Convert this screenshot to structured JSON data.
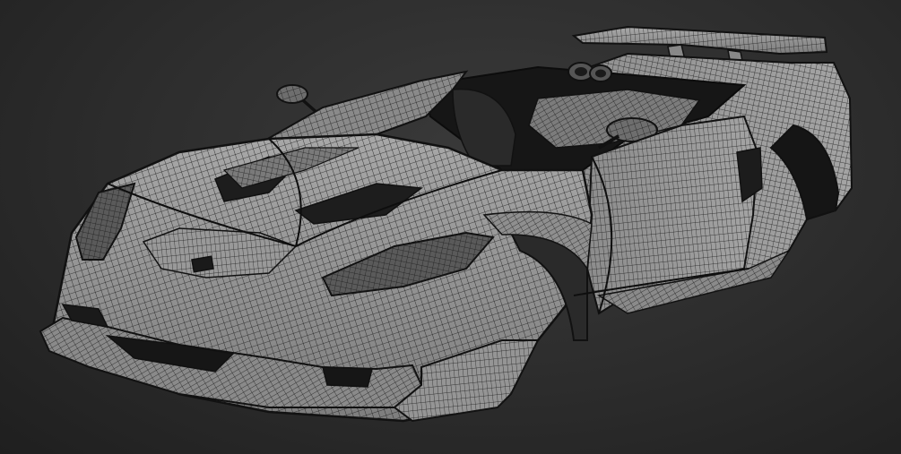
{
  "scene": {
    "subject": "car-body-wireframe-mesh",
    "render_style": "wireframe-over-gray-shaded",
    "colors": {
      "background_top": "#3a3a3a",
      "background_bottom": "#1f1f1f",
      "body_fill": "#9c9c9c",
      "body_fill_shadow": "#7a7a7a",
      "wire": "#1b1b1b",
      "wire_light": "#2a2a2a",
      "cavity": "#111111"
    }
  }
}
